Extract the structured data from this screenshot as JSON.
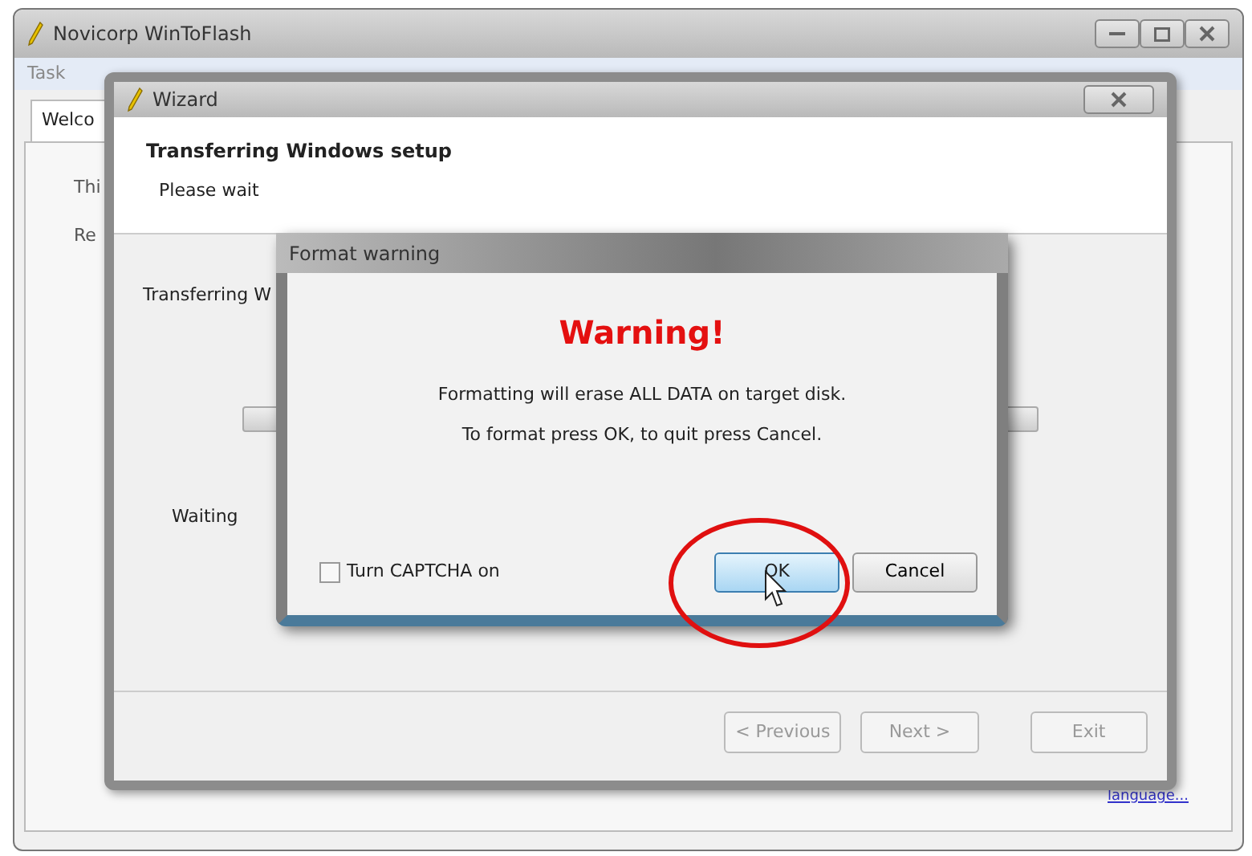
{
  "main_window": {
    "title": "Novicorp WinToFlash",
    "menu": [
      "Task"
    ],
    "tabs": [
      {
        "label": "Welco",
        "selected": true
      }
    ],
    "lines": [
      "Thi",
      "Re"
    ],
    "link": "language..."
  },
  "wizard": {
    "title": "Wizard",
    "heading": "Transferring Windows setup",
    "subheading": "Please wait",
    "status": "Transferring W",
    "progress": {
      "level": 0
    },
    "state": "Waiting",
    "buttons": [
      {
        "label": "< Previous",
        "disabled": true
      },
      {
        "label": "Next >",
        "disabled": true
      },
      {
        "label": "Exit",
        "disabled": true
      }
    ]
  },
  "dialog": {
    "title": "Format warning",
    "warning": "Warning!",
    "message": [
      "Formatting will erase ALL DATA on target disk.",
      "To format press OK, to quit press Cancel."
    ],
    "captcha": {
      "label": "Turn CAPTCHA on",
      "checked": false
    },
    "buttons": [
      {
        "label": "OK",
        "default": true
      },
      {
        "label": "Cancel",
        "default": false
      }
    ],
    "annotation": {
      "kind": "circle"
    }
  }
}
